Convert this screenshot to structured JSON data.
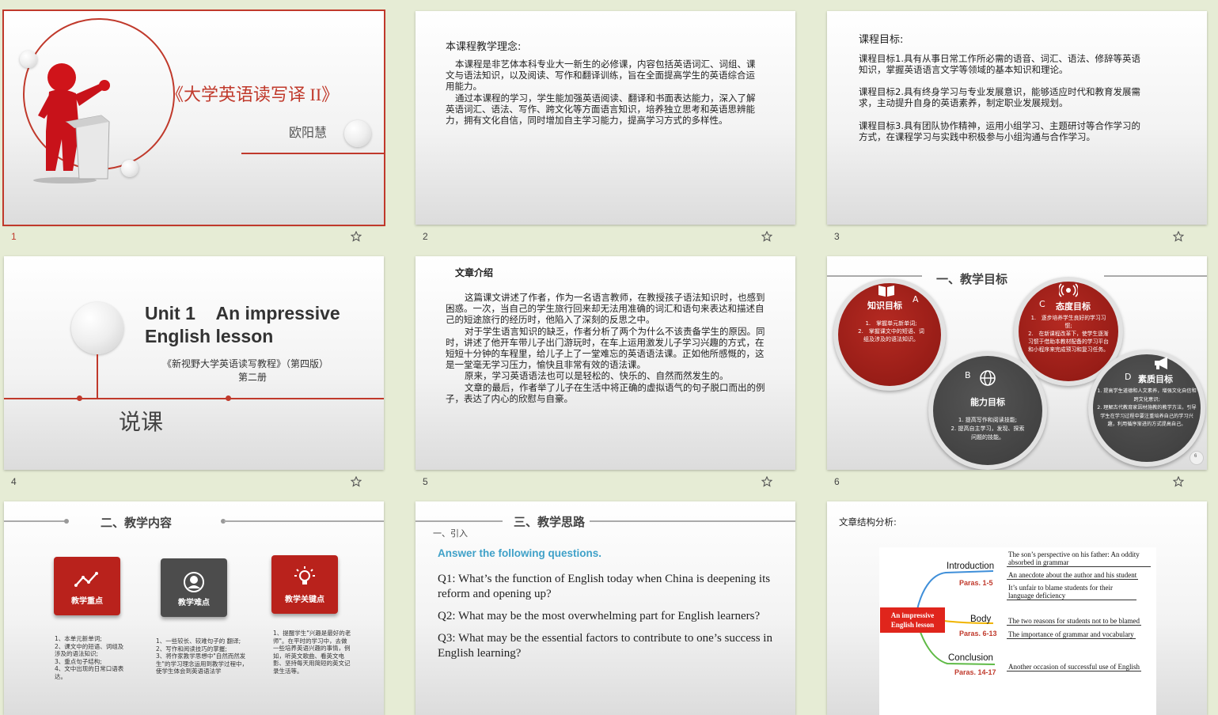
{
  "slides": [
    {
      "number": "1",
      "title": "《大学英语读写译 II》",
      "author": "欧阳慧"
    },
    {
      "number": "2",
      "heading": "本课程教学理念:",
      "p1": "本课程是非艺体本科专业大一新生的必修课，内容包括英语词汇、词组、课文与语法知识，以及阅读、写作和翻译训练，旨在全面提高学生的英语综合运用能力。",
      "p2": "通过本课程的学习，学生能加强英语阅读、翻译和书面表达能力，深入了解英语词汇、语法、写作、跨文化等方面语言知识，培养独立思考和英语思辨能力，拥有文化自信，同时增加自主学习能力，提高学习方式的多样性。"
    },
    {
      "number": "3",
      "heading": "课程目标:",
      "g1": "课程目标1.具有从事日常工作所必需的语音、词汇、语法、修辞等英语知识，掌握英语语言文学等领域的基本知识和理论。",
      "g2": "课程目标2.具有终身学习与专业发展意识，能够适应时代和教育发展需求，主动提升自身的英语素养，制定职业发展规划。",
      "g3": "课程目标3.具有团队协作精神，运用小组学习、主题研讨等合作学习的方式，在课程学习与实践中积极参与小组沟通与合作学习。"
    },
    {
      "number": "4",
      "unit": "Unit 1",
      "title_a": "An impressive",
      "title_b": "English lesson",
      "book": "《新视野大学英语读写教程》（第四版）",
      "volume": "第二册",
      "label": "说课"
    },
    {
      "number": "5",
      "heading": "文章介绍",
      "p1": "这篇课文讲述了作者，作为一名语言教师，在教授孩子语法知识时，也感到困惑。一次，当自己的学生旅行回来却无法用准确的词汇和语句来表达和描述自己的短途旅行的经历时，他陷入了深刻的反思之中。",
      "p2": "对于学生语言知识的缺乏，作者分析了两个为什么不该责备学生的原因。同时，讲述了他开车带儿子出门游玩时，在车上运用激发儿子学习兴趣的方式，在短短十分钟的车程里，给儿子上了一堂难忘的英语语法课。正如他所感慨的，这是一堂毫无学习压力，愉快且非常有效的语法课。",
      "p3": "原来，学习英语语法也可以是轻松的、快乐的、自然而然发生的。",
      "p4": "文章的最后，作者举了儿子在生活中将正确的虚拟语气的句子脱口而出的例子，表达了内心的欣慰与自豪。"
    },
    {
      "number": "6",
      "heading": "一、教学目标",
      "A": {
        "letter": "A",
        "title": "知识目标",
        "items": [
          "1.　掌握单元新单词;",
          "2.　掌握课文中的短语、词组及涉及的语法知识。"
        ]
      },
      "C": {
        "letter": "C",
        "title": "态度目标",
        "items": [
          "1.　逐步培养学生良好的学习习惯;",
          "2.　在新课程改革下，使学生逐渐习惯于借助本教材配备的学习平台和小程序来完成预习和复习任务。"
        ]
      },
      "B": {
        "letter": "B",
        "title": "能力目标",
        "items": [
          "1. 提高写作和阅读技能;",
          "2. 提高自主学习，发现、探索问题的技能。"
        ]
      },
      "D": {
        "letter": "D",
        "title": "素质目标",
        "items": [
          "1. 提高学生道德和人文素养，增强文化自信和跨文化意识;",
          "2. 理解古代教育家因材施教的教学方法，引导学生在学习过程中要注重培养自己的学习兴趣，利用循序渐进的方式提高自己。"
        ]
      },
      "page": "6"
    },
    {
      "number": "",
      "heading": "二、教学内容",
      "boxes": [
        {
          "label": "教学重点",
          "items": [
            "1、本单元新单词;",
            "2、课文中的短语、词组及涉及的语法知识;",
            "3、重点句子结构;",
            "4、文中出现的日常口语表达。"
          ]
        },
        {
          "label": "教学难点",
          "items": [
            "1、一些较长、较难句子的 翻译;",
            "2、写作和阅读技巧的掌握;",
            "3、将作家教学思想中\"自然而然发生\"的学习理念运用到教学过程中，使学生体会到英语语法学"
          ]
        },
        {
          "label": "教学关键点",
          "items": [
            "1、提醒学生\"兴趣是最好的老师\"。在平时的学习中，去做一些培养英语兴趣的事情，例如，听英文歌曲、看英文电影、坚持每天用简短的英文记录生活等。"
          ]
        }
      ]
    },
    {
      "number": "",
      "heading": "三、教学思路",
      "sub": "一、引入",
      "prompt": "Answer the following questions.",
      "q1": "Q1: What’s the function of English today when China is deepening its reform and opening up?",
      "q2": "Q2: What may be the most overwhelming part for English learners?",
      "q3": "Q3: What may be the essential factors to contribute to one’s success in English learning?"
    },
    {
      "number": "",
      "heading": "文章结构分析:",
      "center": "An impressive English lesson",
      "intro": "Introduction",
      "intro_paras": "Paras. 1-5",
      "body": "Body",
      "body_paras": "Paras. 6-13",
      "concl": "Conclusion",
      "concl_paras": "Paras. 14-17",
      "a1": "The son’s perspective on his father: An oddity absorbed in grammar",
      "a2": "An anecdote about the author and his student",
      "a3": "It’s unfair to blame students for their language deficiency",
      "a4": "The two reasons for students not to be blamed",
      "a5": "The importance of grammar and vocabulary",
      "a6": "Another occasion of successful use of English"
    }
  ],
  "colors": {
    "accent": "#c0392b",
    "dark": "#4a4a4a",
    "teal": "#3fa1c8"
  }
}
